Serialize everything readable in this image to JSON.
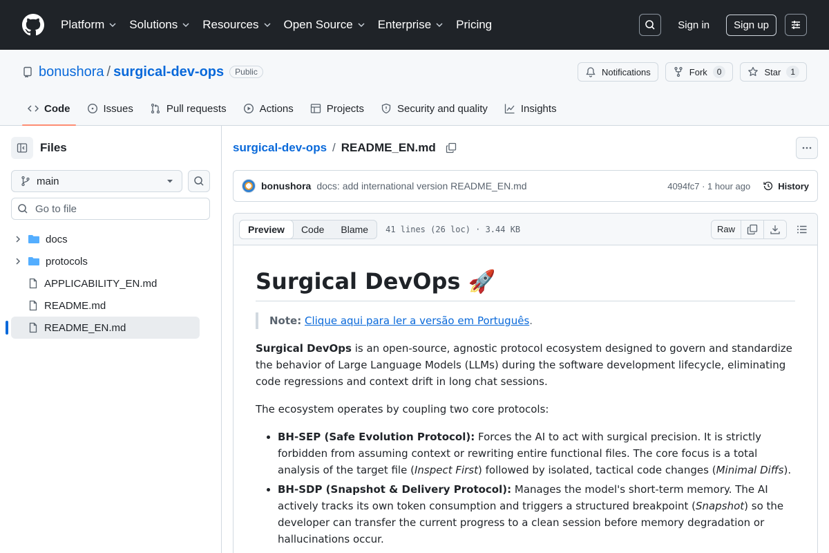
{
  "topnav": {
    "items": [
      "Platform",
      "Solutions",
      "Resources",
      "Open Source",
      "Enterprise",
      "Pricing"
    ],
    "signin": "Sign in",
    "signup": "Sign up"
  },
  "repo": {
    "owner": "bonushora",
    "name": "surgical-dev-ops",
    "visibility": "Public",
    "notifications": "Notifications",
    "fork_label": "Fork",
    "fork_count": "0",
    "star_label": "Star",
    "star_count": "1",
    "tabs": [
      "Code",
      "Issues",
      "Pull requests",
      "Actions",
      "Projects",
      "Security and quality",
      "Insights"
    ]
  },
  "sidebar": {
    "title": "Files",
    "branch": "main",
    "goto_placeholder": "Go to file",
    "tree": [
      {
        "name": "docs",
        "type": "folder"
      },
      {
        "name": "protocols",
        "type": "folder"
      },
      {
        "name": "APPLICABILITY_EN.md",
        "type": "file"
      },
      {
        "name": "README.md",
        "type": "file"
      },
      {
        "name": "README_EN.md",
        "type": "file",
        "selected": true
      }
    ]
  },
  "content": {
    "breadcrumb_repo": "surgical-dev-ops",
    "breadcrumb_sep": "/",
    "breadcrumb_file": "README_EN.md",
    "commit": {
      "author": "bonushora",
      "message": "docs: add international version README_EN.md",
      "meta": "4094fc7 · 1 hour ago",
      "history": "History"
    },
    "toolbar": {
      "preview": "Preview",
      "code": "Code",
      "blame": "Blame",
      "info": "41 lines (26 loc) · 3.44 KB",
      "raw": "Raw"
    },
    "markdown": {
      "h1": "Surgical DevOps 🚀",
      "note_label": "Note:",
      "note_link": "Clique aqui para ler a versão em Português",
      "note_end": ".",
      "p1_bold": "Surgical DevOps",
      "p1_rest": " is an open-source, agnostic protocol ecosystem designed to govern and standardize the behavior of Large Language Models (LLMs) during the software development lifecycle, eliminating code regressions and context drift in long chat sessions.",
      "p2": "The ecosystem operates by coupling two core protocols:",
      "li1_bold": "BH-SEP (Safe Evolution Protocol):",
      "li1_a": " Forces the AI to act with surgical precision. It is strictly forbidden from assuming context or rewriting entire functional files. The core focus is a total analysis of the target file (",
      "li1_i1": "Inspect First",
      "li1_b": ") followed by isolated, tactical code changes (",
      "li1_i2": "Minimal Diffs",
      "li1_c": ").",
      "li2_bold": "BH-SDP (Snapshot & Delivery Protocol):",
      "li2_a": " Manages the model's short-term memory. The AI actively tracks its own token consumption and triggers a structured breakpoint (",
      "li2_i1": "Snapshot",
      "li2_b": ") so the developer can transfer the current progress to a clean session before memory degradation or hallucinations occur."
    }
  }
}
